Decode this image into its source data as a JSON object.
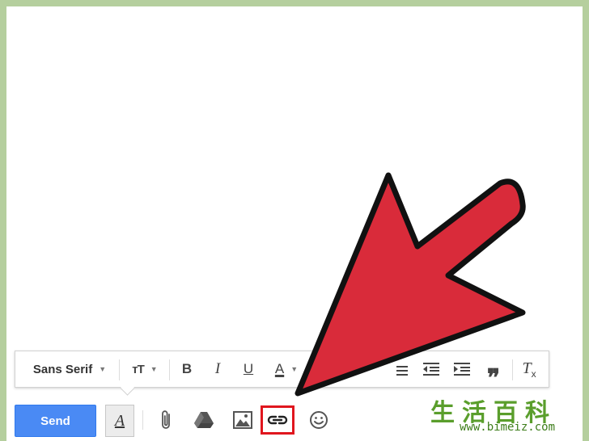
{
  "formatting_toolbar": {
    "font_family": "Sans Serif",
    "size_label": "тT",
    "bold_label": "B",
    "italic_label": "I",
    "underline_label": "U",
    "text_color_label": "A",
    "quote_label": "❞",
    "clear_format_label": "T"
  },
  "bottom_toolbar": {
    "send_label": "Send",
    "formatting_toggle_label": "A"
  },
  "watermark": {
    "chars": "生活百科",
    "url": "www.bimeiz.com"
  },
  "colors": {
    "send_button": "#4a8af4",
    "highlight_box": "#e0161e",
    "arrow_fill": "#d92b3a",
    "background_border": "#b5cf9e"
  },
  "icons": [
    "paperclip-icon",
    "drive-icon",
    "photo-icon",
    "link-icon",
    "emoji-icon"
  ]
}
